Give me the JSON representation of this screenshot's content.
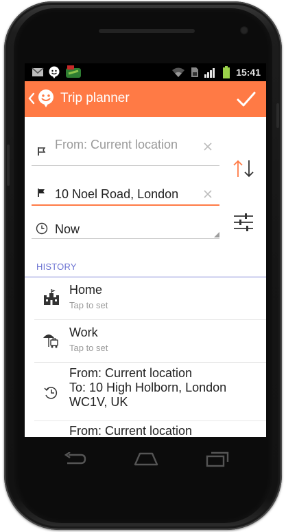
{
  "status_bar": {
    "time": "15:41"
  },
  "app_bar": {
    "title": "Trip planner"
  },
  "form": {
    "from_text": "From: Current location",
    "to_text": "10 Noel Road, London",
    "time_text": "Now"
  },
  "history": {
    "section_label": "HISTORY",
    "items": [
      {
        "title": "Home",
        "subtitle": "Tap to set",
        "icon": "home-castle-icon"
      },
      {
        "title": "Work",
        "subtitle": "Tap to set",
        "icon": "work-umbrella-icon"
      },
      {
        "line1": "From: Current location",
        "line2": "To: 10 High Holborn, London",
        "line3": "WC1V, UK",
        "icon": "clock-icon"
      },
      {
        "line1": "From: Current location",
        "icon": "clock-icon"
      }
    ]
  },
  "colors": {
    "accent": "#ff7a45",
    "section": "#6b72d2"
  }
}
